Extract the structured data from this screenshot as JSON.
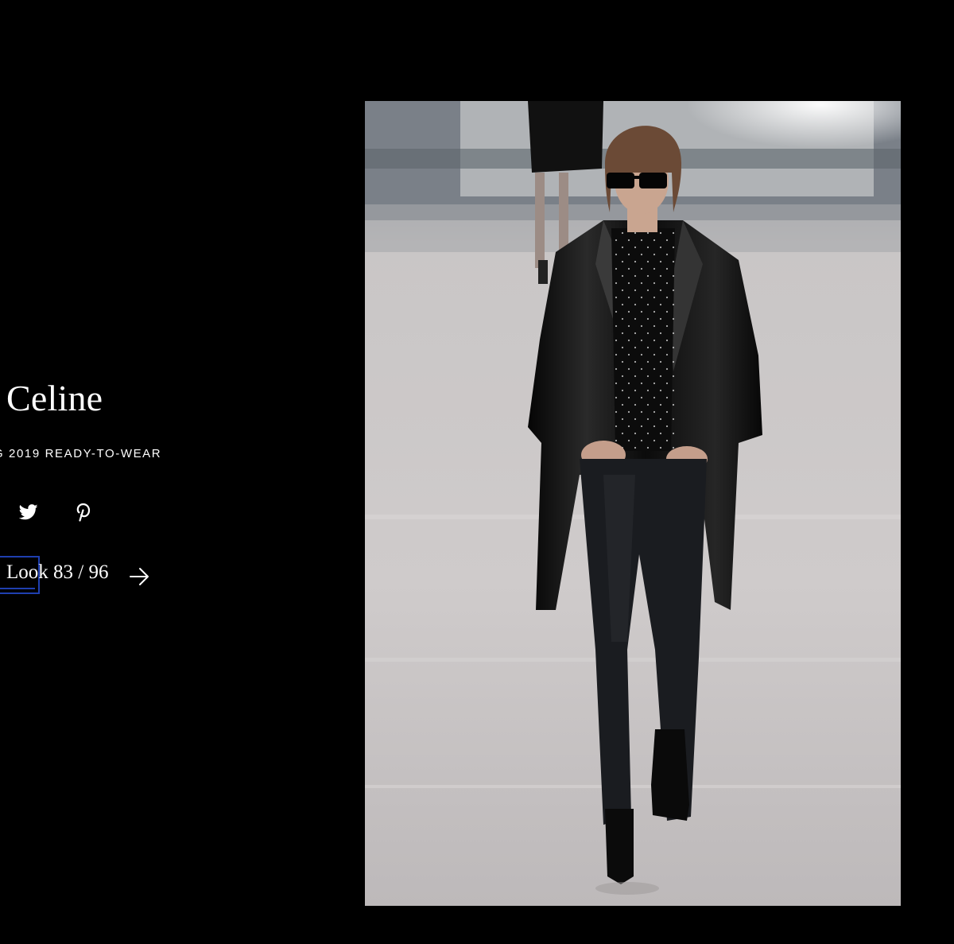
{
  "designer": "Celine",
  "season": "G 2019 READY-TO-WEAR",
  "social": {
    "icons": [
      "twitter-icon",
      "pinterest-icon"
    ]
  },
  "look": {
    "counter": "Look 83 / 96"
  },
  "icons": {
    "next": "arrow-right-icon"
  },
  "colors": {
    "background": "#000000",
    "focus_outline": "#1f3fb0",
    "text": "#ffffff"
  }
}
